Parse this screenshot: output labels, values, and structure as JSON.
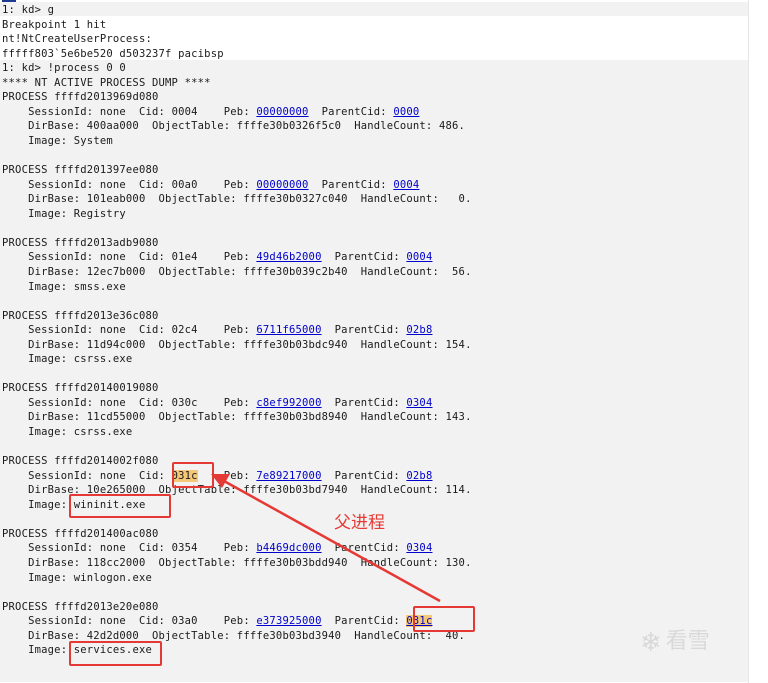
{
  "header_lines": [
    "1: kd> g",
    "Breakpoint 1 hit",
    "nt!NtCreateUserProcess:",
    "fffff803`5e6be520 d503237f pacibsp",
    "1: kd> !process 0 0",
    "**** NT ACTIVE PROCESS DUMP ****"
  ],
  "processes": [
    {
      "process": "ffffd2013969d080",
      "session": "none",
      "cid": "0004",
      "peb": "00000000",
      "parent": "0000",
      "dirbase": "400aa000",
      "objtable": "ffffe30b0326f5c0",
      "handlecount": "486.",
      "image": "System"
    },
    {
      "process": "ffffd201397ee080",
      "session": "none",
      "cid": "00a0",
      "peb": "00000000",
      "parent": "0004",
      "dirbase": "101eab000",
      "objtable": "ffffe30b0327c040",
      "handlecount": "  0.",
      "image": "Registry"
    },
    {
      "process": "ffffd2013adb9080",
      "session": "none",
      "cid": "01e4",
      "peb": "49d46b2000",
      "parent": "0004",
      "dirbase": "12ec7b000",
      "objtable": "ffffe30b039c2b40",
      "handlecount": " 56.",
      "image": "smss.exe"
    },
    {
      "process": "ffffd2013e36c080",
      "session": "none",
      "cid": "02c4",
      "peb": "6711f65000",
      "parent": "02b8",
      "dirbase": "11d94c000",
      "objtable": "ffffe30b03bdc940",
      "handlecount": "154.",
      "image": "csrss.exe"
    },
    {
      "process": "ffffd20140019080",
      "session": "none",
      "cid": "030c",
      "peb": "c8ef992000",
      "parent": "0304",
      "dirbase": "11cd55000",
      "objtable": "ffffe30b03bd8940",
      "handlecount": "143.",
      "image": "csrss.exe"
    },
    {
      "process": "ffffd2014002f080",
      "session": "none",
      "cid": "031c",
      "peb": "7e89217000",
      "parent": "02b8",
      "dirbase": "10e265000",
      "objtable": "ffffe30b03bd7940",
      "handlecount": "114.",
      "image": "wininit.exe"
    },
    {
      "process": "ffffd201400ac080",
      "session": "none",
      "cid": "0354",
      "peb": "b4469dc000",
      "parent": "0304",
      "dirbase": "118cc2000",
      "objtable": "ffffe30b03bdd940",
      "handlecount": "130.",
      "image": "winlogon.exe"
    },
    {
      "process": "ffffd2013e20e080",
      "session": "none",
      "cid": "03a0",
      "peb": "e373925000",
      "parent": "031c",
      "dirbase": "42d2d000",
      "objtable": "ffffe30b03bd3940",
      "handlecount": " 40.",
      "image": "services.exe"
    }
  ],
  "annotation": {
    "label": "父进程",
    "color": "#e53935",
    "highlight_color": "#f5c878"
  },
  "watermark": {
    "text": "看雪",
    "icon": "snowflake-icon"
  },
  "colors": {
    "link": "#0000cc",
    "background": "#ffffff",
    "header_bg": "#f2f2f2",
    "text": "#1a1a1a"
  }
}
